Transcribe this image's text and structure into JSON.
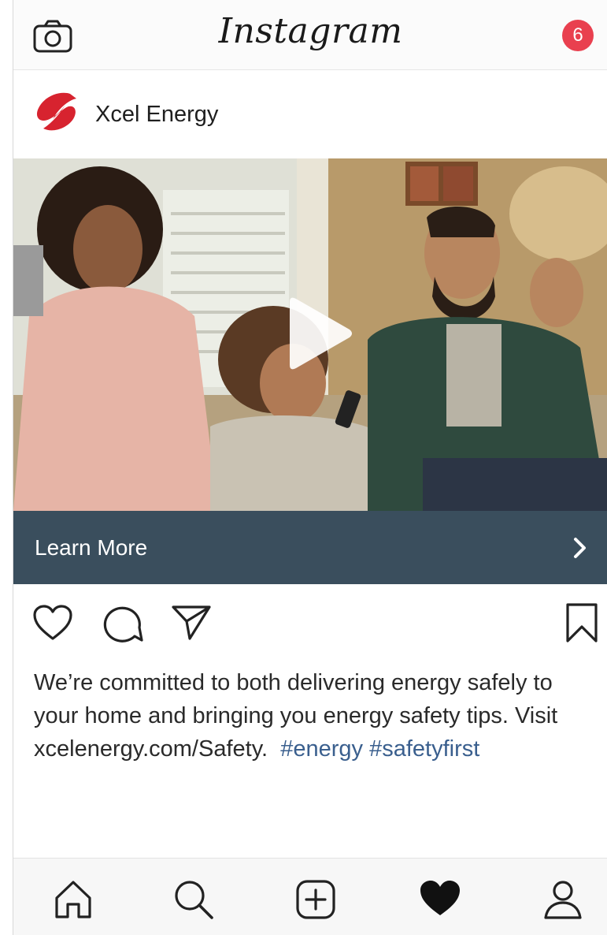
{
  "app": {
    "title": "Instagram",
    "notification_count": "6"
  },
  "post": {
    "account_name": "Xcel Energy",
    "cta_label": "Learn More",
    "caption": {
      "line1": "We’re committed to both delivering energy safely to",
      "line2": "your home and bringing you energy safety tips. Visit",
      "line3_text": "xcelenergy.com/Safety.",
      "hashtags": [
        "#energy",
        "#safetyfirst"
      ]
    }
  },
  "icons": {
    "top_left": "camera-icon",
    "media_overlay": "play-icon",
    "actions": [
      "heart-icon",
      "comment-icon",
      "share-icon",
      "bookmark-icon"
    ],
    "tabs": [
      "home-icon",
      "search-icon",
      "add-post-icon",
      "activity-heart-icon",
      "profile-icon"
    ]
  },
  "colors": {
    "badge": "#e9404f",
    "cta_bar": "#3a4e5d",
    "hashtag": "#3a5f8e",
    "brand_red": "#d7232f"
  }
}
